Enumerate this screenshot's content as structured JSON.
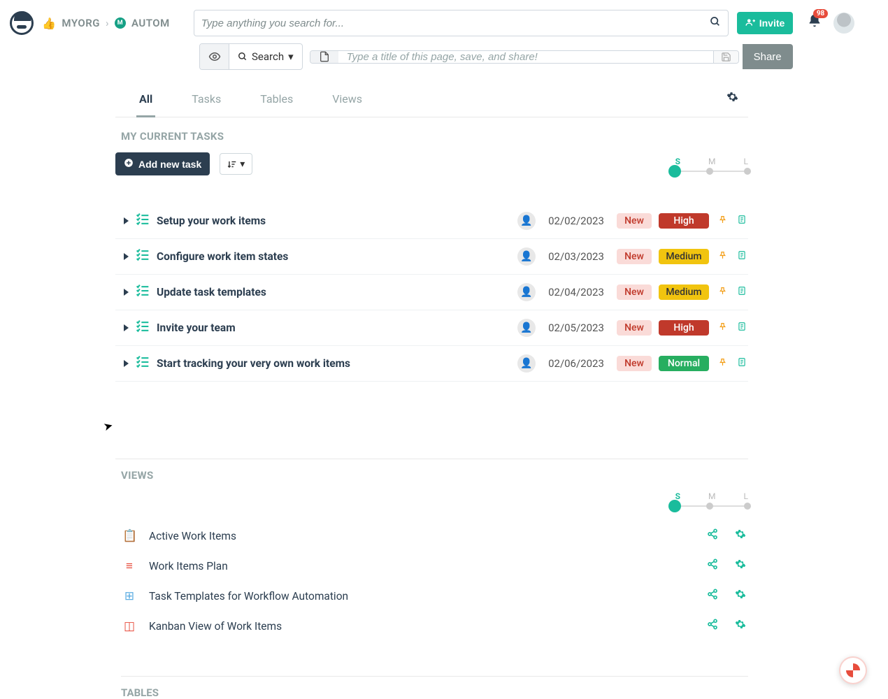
{
  "breadcrumb": {
    "org": "MYORG",
    "project": "AUTOM"
  },
  "search": {
    "placeholder": "Type anything you search for..."
  },
  "invite_label": "Invite",
  "notification_count": "98",
  "toolbar": {
    "search_label": "Search",
    "title_placeholder": "Type a title of this page, save, and share!",
    "share_label": "Share"
  },
  "tabs": {
    "all": "All",
    "tasks": "Tasks",
    "tables": "Tables",
    "views": "Views"
  },
  "section_tasks_head": "MY CURRENT TASKS",
  "add_task_label": "Add new task",
  "size_labels": {
    "s": "S",
    "m": "M",
    "l": "L"
  },
  "tasks_list": [
    {
      "title": "Setup your work items",
      "date": "02/02/2023",
      "state": "New",
      "priority": "High",
      "priority_class": "pill-high"
    },
    {
      "title": "Configure work item states",
      "date": "02/03/2023",
      "state": "New",
      "priority": "Medium",
      "priority_class": "pill-medium"
    },
    {
      "title": "Update task templates",
      "date": "02/04/2023",
      "state": "New",
      "priority": "Medium",
      "priority_class": "pill-medium"
    },
    {
      "title": "Invite your team",
      "date": "02/05/2023",
      "state": "New",
      "priority": "High",
      "priority_class": "pill-high"
    },
    {
      "title": "Start tracking your very own work items",
      "date": "02/06/2023",
      "state": "New",
      "priority": "Normal",
      "priority_class": "pill-normal"
    }
  ],
  "section_views_head": "VIEWS",
  "views_list": [
    {
      "title": "Active Work Items",
      "icon": "📋",
      "color": "#e74c3c"
    },
    {
      "title": "Work Items Plan",
      "icon": "≡",
      "color": "#e74c3c"
    },
    {
      "title": "Task Templates for Workflow Automation",
      "icon": "⊞",
      "color": "#5dade2"
    },
    {
      "title": "Kanban View of Work Items",
      "icon": "◫",
      "color": "#e74c3c"
    }
  ],
  "section_tables_head": "TABLES"
}
